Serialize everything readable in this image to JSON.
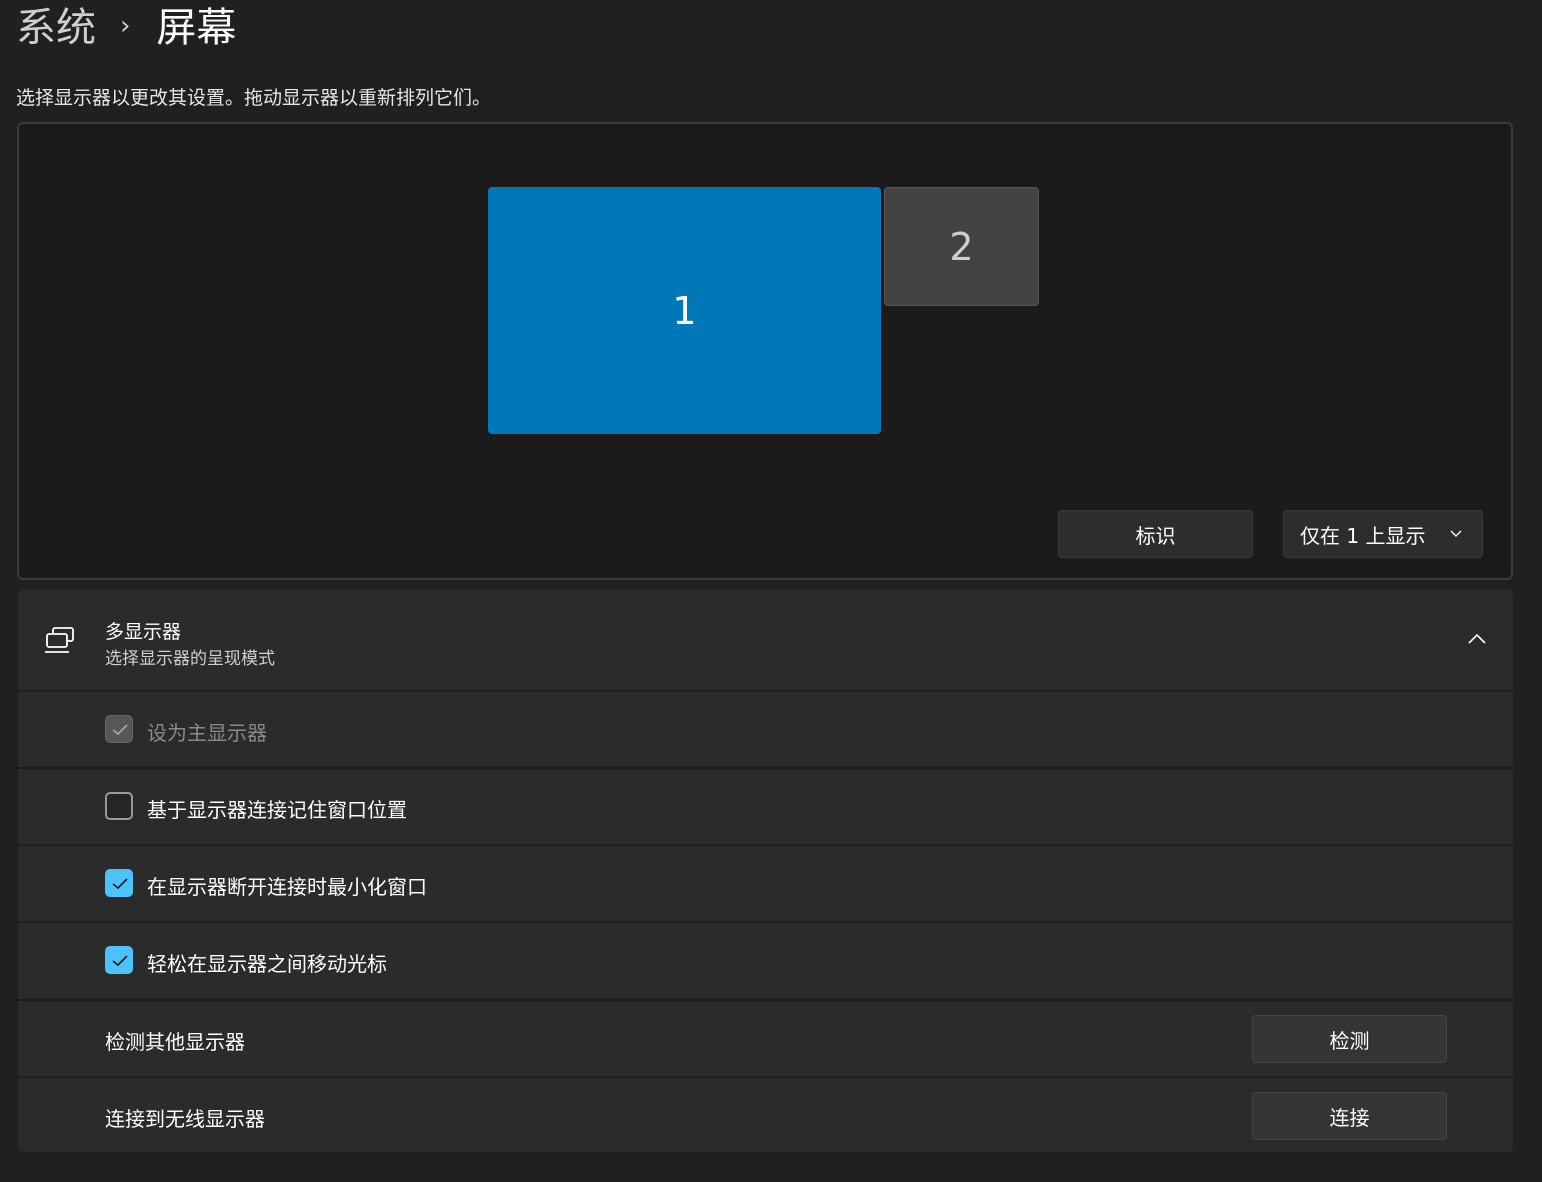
{
  "breadcrumb": {
    "parent": "系统",
    "separator": "›",
    "current": "屏幕"
  },
  "intro_text": "选择显示器以更改其设置。拖动显示器以重新排列它们。",
  "arrangement": {
    "monitors": [
      {
        "label": "1",
        "selected": true,
        "color": "#0078b8"
      },
      {
        "label": "2",
        "selected": false,
        "color": "#434343"
      }
    ],
    "identify_button": "标识",
    "mode_dropdown": {
      "selected": "仅在 1 上显示",
      "icon": "chevron-down-icon"
    }
  },
  "multi_display": {
    "icon": "multi-monitor-icon",
    "title": "多显示器",
    "subtitle": "选择显示器的呈现模式",
    "expanded": true,
    "collapse_icon": "chevron-up-icon",
    "options": [
      {
        "label": "设为主显示器",
        "checked": true,
        "disabled": true
      },
      {
        "label": "基于显示器连接记住窗口位置",
        "checked": false,
        "disabled": false
      },
      {
        "label": "在显示器断开连接时最小化窗口",
        "checked": true,
        "disabled": false
      },
      {
        "label": "轻松在显示器之间移动光标",
        "checked": true,
        "disabled": false
      }
    ],
    "detect": {
      "label": "检测其他显示器",
      "button": "检测"
    },
    "wireless": {
      "label": "连接到无线显示器",
      "button": "连接"
    }
  },
  "colors": {
    "accent": "#4cc2ff",
    "selected_monitor": "#0078b8",
    "background": "#202020",
    "panel": "#2b2b2b"
  }
}
